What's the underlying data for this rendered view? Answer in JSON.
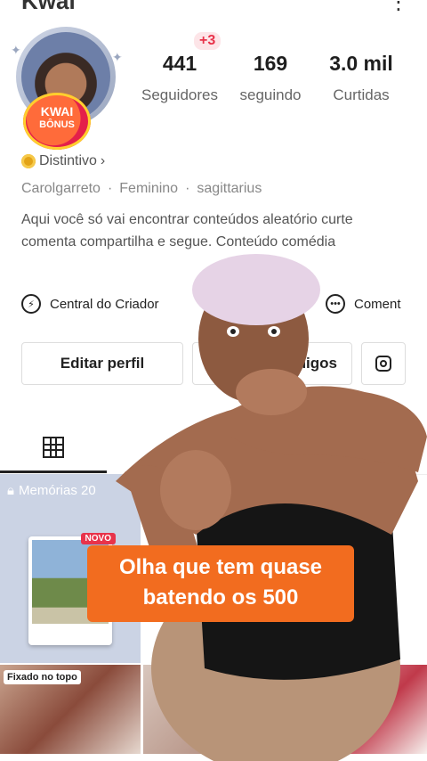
{
  "header": {
    "title": "Kwai",
    "menu_icon": "more-icon"
  },
  "profile": {
    "bonus_badge": {
      "line1": "KWAI",
      "line2": "BÔNUS"
    },
    "new_followers_badge": "+3",
    "stats": [
      {
        "value": "441",
        "label": "Seguidores"
      },
      {
        "value": "169",
        "label": "seguindo"
      },
      {
        "value": "3.0 mil",
        "label": "Curtidas"
      }
    ],
    "distintivo": "Distintivo",
    "meta": [
      "Carolgarreto",
      "Feminino",
      "sagittarius"
    ],
    "bio": "Aqui você só vai encontrar conteúdos aleatório curte comenta compartilha e segue. Conteúdo comédia"
  },
  "actions": {
    "creator_center": "Central do Criador",
    "comments": "Coment",
    "edit_profile": "Editar perfil",
    "friends_partial": "nigos"
  },
  "content": {
    "memories_label": "Memórias 20",
    "new_label": "NOVO",
    "pinned_label": "Fixado no topo"
  },
  "overlay": {
    "caption": "Olha que tem quase batendo os 500"
  },
  "colors": {
    "accent": "#f26c1f",
    "badge_red": "#e8334a"
  }
}
